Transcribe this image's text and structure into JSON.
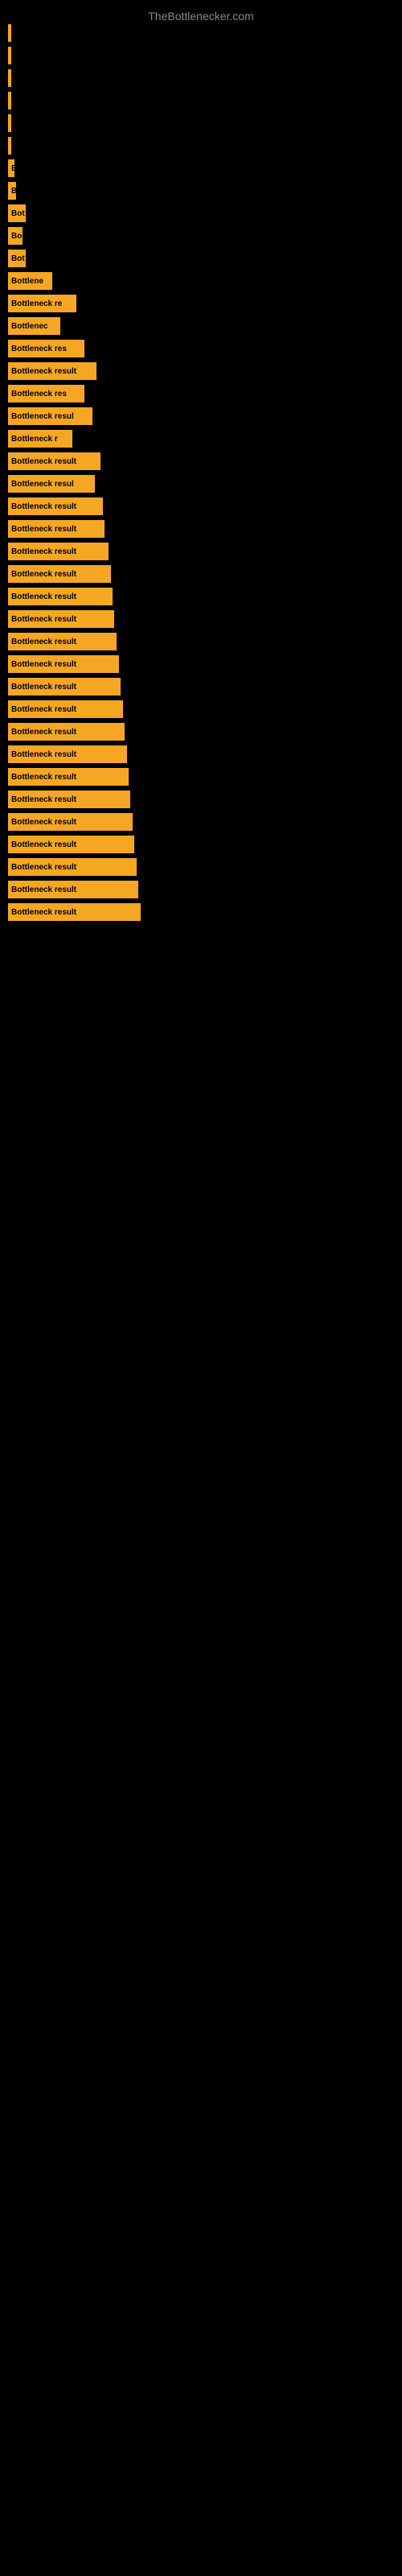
{
  "site": {
    "title": "TheBottlenecker.com"
  },
  "bars": [
    {
      "label": "",
      "width": 2
    },
    {
      "label": "",
      "width": 2
    },
    {
      "label": "",
      "width": 3
    },
    {
      "label": "",
      "width": 2
    },
    {
      "label": "",
      "width": 2
    },
    {
      "label": "",
      "width": 3
    },
    {
      "label": "B",
      "width": 8
    },
    {
      "label": "B",
      "width": 10
    },
    {
      "label": "Bot",
      "width": 22
    },
    {
      "label": "Bo",
      "width": 18
    },
    {
      "label": "Bot",
      "width": 22
    },
    {
      "label": "Bottlene",
      "width": 55
    },
    {
      "label": "Bottleneck re",
      "width": 85
    },
    {
      "label": "Bottlenec",
      "width": 65
    },
    {
      "label": "Bottleneck res",
      "width": 95
    },
    {
      "label": "Bottleneck result",
      "width": 110
    },
    {
      "label": "Bottleneck res",
      "width": 95
    },
    {
      "label": "Bottleneck resul",
      "width": 105
    },
    {
      "label": "Bottleneck r",
      "width": 80
    },
    {
      "label": "Bottleneck result",
      "width": 115
    },
    {
      "label": "Bottleneck resul",
      "width": 108
    },
    {
      "label": "Bottleneck result",
      "width": 118
    },
    {
      "label": "Bottleneck result",
      "width": 120
    },
    {
      "label": "Bottleneck result",
      "width": 125
    },
    {
      "label": "Bottleneck result",
      "width": 128
    },
    {
      "label": "Bottleneck result",
      "width": 130
    },
    {
      "label": "Bottleneck result",
      "width": 132
    },
    {
      "label": "Bottleneck result",
      "width": 135
    },
    {
      "label": "Bottleneck result",
      "width": 138
    },
    {
      "label": "Bottleneck result",
      "width": 140
    },
    {
      "label": "Bottleneck result",
      "width": 143
    },
    {
      "label": "Bottleneck result",
      "width": 145
    },
    {
      "label": "Bottleneck result",
      "width": 148
    },
    {
      "label": "Bottleneck result",
      "width": 150
    },
    {
      "label": "Bottleneck result",
      "width": 152
    },
    {
      "label": "Bottleneck result",
      "width": 155
    },
    {
      "label": "Bottleneck result",
      "width": 157
    },
    {
      "label": "Bottleneck result",
      "width": 160
    },
    {
      "label": "Bottleneck result",
      "width": 162
    },
    {
      "label": "Bottleneck result",
      "width": 165
    }
  ]
}
